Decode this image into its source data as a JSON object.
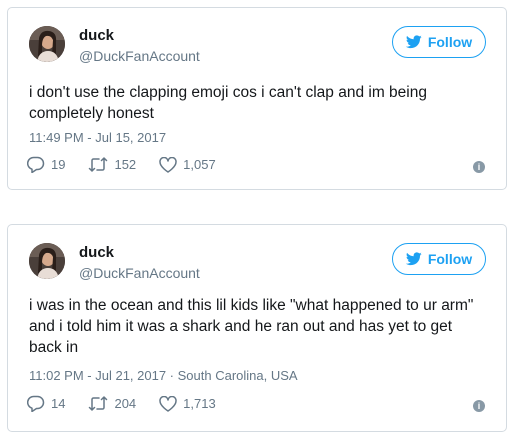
{
  "tweets": [
    {
      "name": "duck",
      "handle": "@DuckFanAccount",
      "follow_label": "Follow",
      "text": "i don't use the clapping emoji cos i can't clap and im being completely honest",
      "meta": "11:49 PM - Jul 15, 2017",
      "replies": "19",
      "retweets": "152",
      "likes": "1,057",
      "info_glyph": "i"
    },
    {
      "name": "duck",
      "handle": "@DuckFanAccount",
      "follow_label": "Follow",
      "text": "i was in the ocean and this lil kids like \"what happened to ur arm\" and i told him it was a shark and he ran out and has yet to get back in",
      "meta": "11:02 PM - Jul 21, 2017 · South Carolina, USA",
      "replies": "14",
      "retweets": "204",
      "likes": "1,713",
      "info_glyph": "i"
    }
  ],
  "colors": {
    "accent": "#1da1f2",
    "secondary_text": "#657786",
    "border": "#d4dbe1"
  },
  "icons": [
    "avatar-photo",
    "twitter-bird-icon",
    "reply-icon",
    "retweet-icon",
    "heart-icon",
    "info-icon"
  ]
}
